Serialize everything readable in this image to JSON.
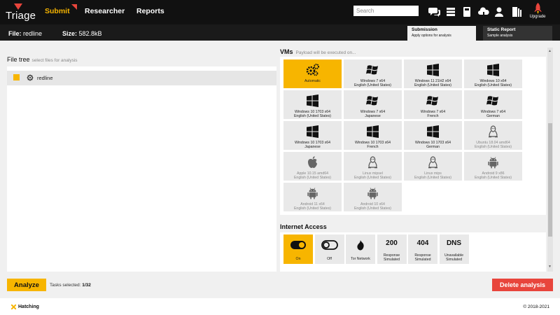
{
  "nav": {
    "brand": "Triage",
    "links": [
      "Submit",
      "Researcher",
      "Reports"
    ],
    "search_placeholder": "Search",
    "upgrade_label": "Upgrade",
    "icons": [
      "chat-icon",
      "list-icon",
      "book-icon",
      "cloud-icon",
      "user-icon",
      "logout-icon",
      "rocket-icon"
    ]
  },
  "header": {
    "file_label": "File:",
    "file_name": "redline",
    "size_label": "Size:",
    "size_value": "582.8kB",
    "steps": [
      {
        "title": "Submission",
        "subtitle": "Apply options for analysis"
      },
      {
        "title": "Static Report",
        "subtitle": "Sample analysis"
      }
    ]
  },
  "filetree": {
    "title": "File tree",
    "subtitle": "select files for analysis",
    "items": [
      {
        "name": "redline",
        "checked": true
      }
    ]
  },
  "vms": {
    "title": "VMs",
    "subtitle": "Payload will be executed on...",
    "items": [
      {
        "icon": "gears-icon",
        "line1": "Automatic",
        "line2": "",
        "selected": true
      },
      {
        "icon": "windows7-icon",
        "line1": "Windows 7 x64",
        "line2": "English (United States)"
      },
      {
        "icon": "windows10-icon",
        "line1": "Windows 11 21H2 x64",
        "line2": "English (United States)"
      },
      {
        "icon": "windows10-icon",
        "line1": "Windows 10 x64",
        "line2": "English (United States)"
      },
      {
        "icon": "windows10-icon",
        "line1": "Windows 10 1703 x64",
        "line2": "English (United States)"
      },
      {
        "icon": "windows7-icon",
        "line1": "Windows 7 x64",
        "line2": "Japanese"
      },
      {
        "icon": "windows7-icon",
        "line1": "Windows 7 x64",
        "line2": "French"
      },
      {
        "icon": "windows7-icon",
        "line1": "Windows 7 x64",
        "line2": "German"
      },
      {
        "icon": "windows10-icon",
        "line1": "Windows 10 1703 x64",
        "line2": "Japanese"
      },
      {
        "icon": "windows10-icon",
        "line1": "Windows 10 1703 x64",
        "line2": "French"
      },
      {
        "icon": "windows10-icon",
        "line1": "Windows 10 1703 x64",
        "line2": "German"
      },
      {
        "icon": "linux-icon",
        "line1": "Ubuntu 18.04 amd64",
        "line2": "English (United States)",
        "dim": true
      },
      {
        "icon": "apple-icon",
        "line1": "Apple 10.15 amd64",
        "line2": "English (United States)",
        "dim": true
      },
      {
        "icon": "linux-icon",
        "line1": "Linux mipsel",
        "line2": "English (United States)",
        "dim": true
      },
      {
        "icon": "linux-icon",
        "line1": "Linux mips",
        "line2": "English (United States)",
        "dim": true
      },
      {
        "icon": "android-icon",
        "line1": "Android 9 x86",
        "line2": "English (United States)",
        "dim": true
      },
      {
        "icon": "android-icon",
        "line1": "Android 11 x64",
        "line2": "English (United States)",
        "dim": true
      },
      {
        "icon": "android-icon",
        "line1": "Android 10 x64",
        "line2": "English (United States)",
        "dim": true
      }
    ]
  },
  "internet": {
    "title": "Internet Access",
    "options": [
      {
        "icon": "toggle-on-icon",
        "big": "",
        "cap1": "On",
        "cap2": "",
        "selected": true
      },
      {
        "icon": "toggle-off-icon",
        "big": "",
        "cap1": "Off",
        "cap2": ""
      },
      {
        "icon": "tor-icon",
        "big": "",
        "cap1": "Tor Network",
        "cap2": ""
      },
      {
        "icon": "",
        "big": "200",
        "cap1": "Response",
        "cap2": "Simulated"
      },
      {
        "icon": "",
        "big": "404",
        "cap1": "Response",
        "cap2": "Simulated"
      },
      {
        "icon": "",
        "big": "DNS",
        "cap1": "Unavailable",
        "cap2": "Simulated"
      }
    ]
  },
  "actions": {
    "analyze_label": "Analyze",
    "tasks_label": "Tasks selected:",
    "tasks_value": "1/32",
    "delete_label": "Delete analysis"
  },
  "footer": {
    "brand": "Hatching",
    "copyright": "© 2018-2021"
  },
  "colors": {
    "accent": "#f7b500",
    "danger": "#e8453c",
    "nav_bg": "#111111"
  }
}
